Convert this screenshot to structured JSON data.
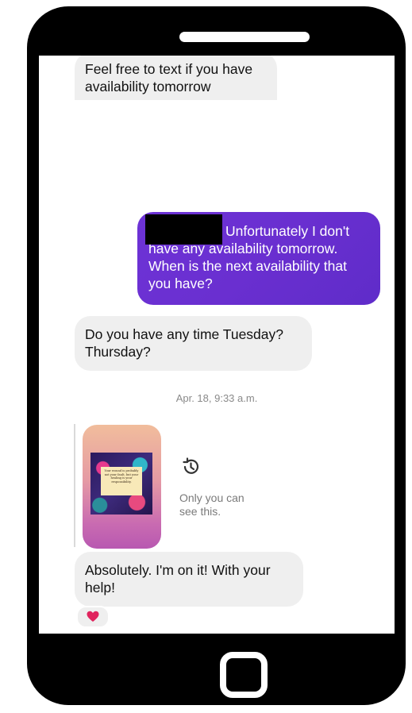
{
  "messages": {
    "m1": "Feel free to text if you have availability tomorrow",
    "m2": "Unfortunately I don't have any availability tomorrow. When is the next availability that you have?",
    "m3": "Do you have any time Tuesday? Thursday?",
    "m4": "Absolutely. I'm on it! With your help!"
  },
  "timestamp": "Apr. 18, 9:33 a.m.",
  "story_reply": {
    "note": "Only you can see this.",
    "card_text": "Your wound is probably not your fault, but your healing is your responsibility.",
    "card_author": "",
    "icon": "history-icon"
  },
  "reaction": {
    "icon": "heart-icon",
    "color": "#e0245e"
  },
  "colors": {
    "outgoing_bubble": "#6a2fd0",
    "incoming_bubble": "#efefef"
  }
}
